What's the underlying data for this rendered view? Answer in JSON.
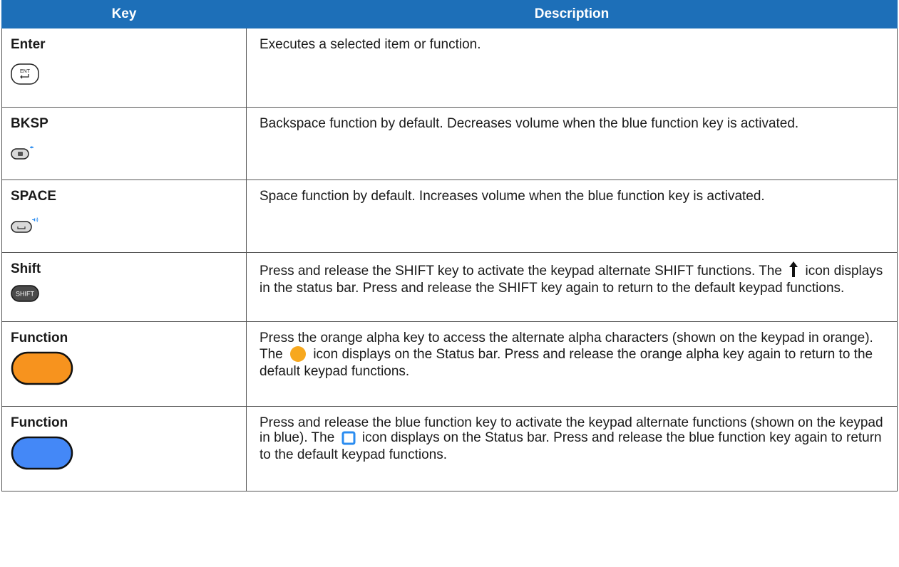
{
  "header": {
    "key": "Key",
    "description": "Description"
  },
  "rows": [
    {
      "key": "Enter",
      "icon": "enter-key-icon",
      "desc": [
        "Executes a selected item or function."
      ]
    },
    {
      "key": "BKSP",
      "icon": "backspace-key-icon",
      "desc": [
        "Backspace function by default. Decreases volume when the blue function key is activated."
      ]
    },
    {
      "key": "SPACE",
      "icon": "space-key-icon",
      "desc": [
        "Space function by default. Increases volume when the blue function key is activated."
      ]
    },
    {
      "key": "Shift",
      "icon": "shift-key-icon",
      "icon_label": "SHIFT",
      "desc_a": "Press and release the SHIFT key to activate the keypad alternate SHIFT functions. The",
      "desc_b": "icon displays in the status bar. Press and release the SHIFT key again to return to the default keypad functions."
    },
    {
      "key": "Function",
      "icon": "orange-alpha-key-icon",
      "desc_a": "Press the orange alpha key to access the alternate alpha characters (shown on the keypad in orange). The",
      "desc_b": "icon displays on the Status bar. Press and release the orange alpha key again to return to the default keypad functions."
    },
    {
      "key": "Function",
      "icon": "blue-function-key-icon",
      "desc_a": "Press and release the blue function key to activate the keypad alternate functions (shown on the keypad in blue). The",
      "desc_b": "icon displays on the Status bar. Press and release the blue function key again to return to the default keypad functions."
    }
  ],
  "enter_icon_label": "ENT",
  "colors": {
    "header_bg": "#1d6fb8",
    "orange": "#f7931e",
    "blue": "#4488f7",
    "status_blue": "#2a8cf0"
  }
}
